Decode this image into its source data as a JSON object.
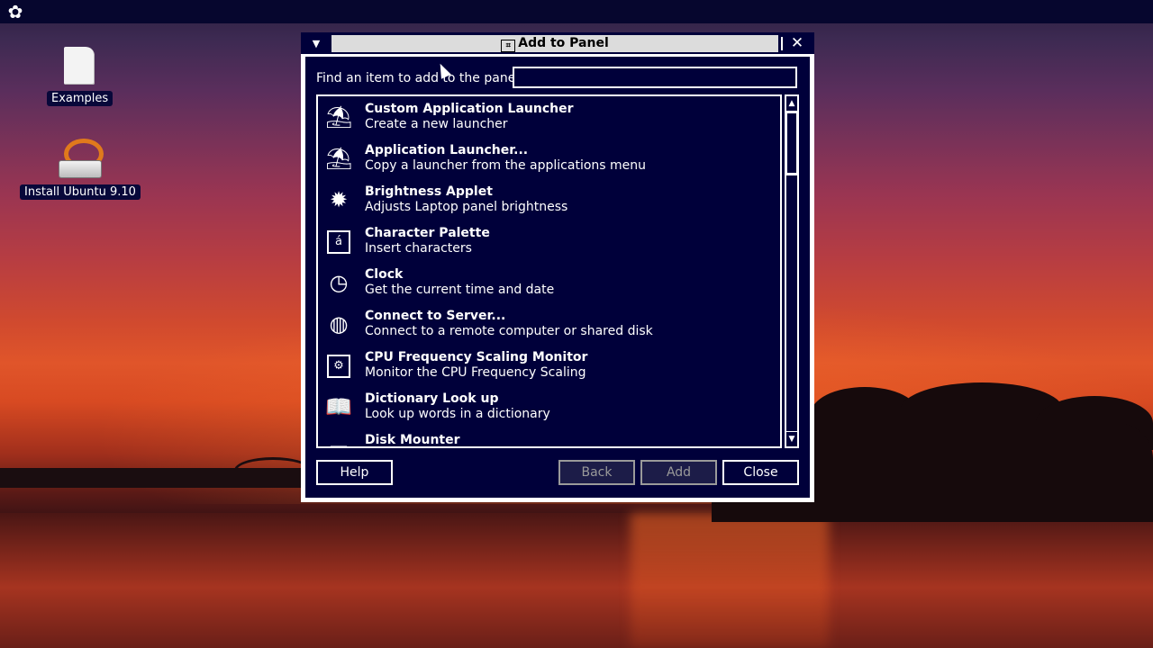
{
  "desktop": {
    "icons": [
      {
        "label": "Examples"
      },
      {
        "label": "Install Ubuntu 9.10"
      }
    ],
    "panel_icon": "gnome-foot-icon"
  },
  "dialog": {
    "title": "Add to Panel",
    "title_icon_glyph": "⌗",
    "menu_glyph": "▼",
    "close_glyph": "✕",
    "find_label": "Find an item to add to the panel:",
    "find_value": "",
    "items": [
      {
        "title": "Custom Application Launcher",
        "desc": "Create a new launcher",
        "icon": "launcher-icon"
      },
      {
        "title": "Application Launcher...",
        "desc": "Copy a launcher from the applications menu",
        "icon": "launcher-icon"
      },
      {
        "title": "Brightness Applet",
        "desc": "Adjusts Laptop panel brightness",
        "icon": "sun-icon"
      },
      {
        "title": "Character Palette",
        "desc": "Insert characters",
        "icon": "character-palette-icon"
      },
      {
        "title": "Clock",
        "desc": "Get the current time and date",
        "icon": "clock-icon"
      },
      {
        "title": "Connect to Server...",
        "desc": "Connect to a remote computer or shared disk",
        "icon": "globe-icon"
      },
      {
        "title": "CPU Frequency Scaling Monitor",
        "desc": "Monitor the CPU Frequency Scaling",
        "icon": "cpu-icon"
      },
      {
        "title": "Dictionary Look up",
        "desc": "Look up words in a dictionary",
        "icon": "book-icon"
      },
      {
        "title": "Disk Mounter",
        "desc": "",
        "icon": "disk-icon"
      }
    ],
    "buttons": {
      "help": "Help",
      "back": "Back",
      "add": "Add",
      "close": "Close"
    }
  }
}
